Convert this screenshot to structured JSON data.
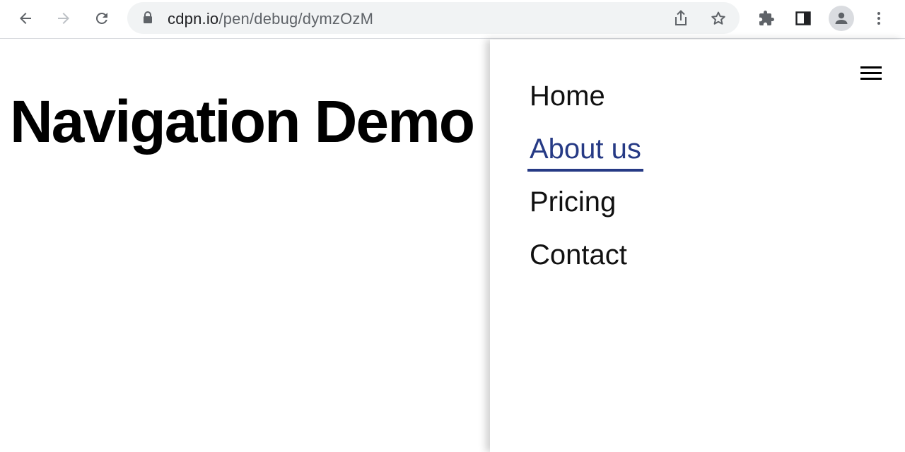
{
  "browser": {
    "url_host": "cdpn.io",
    "url_path": "/pen/debug/dymzOzM",
    "icons": [
      "back-arrow-icon",
      "forward-arrow-icon",
      "reload-icon",
      "lock-icon",
      "share-icon",
      "star-icon",
      "extensions-icon",
      "side-panel-icon",
      "profile-icon",
      "menu-dots-icon"
    ]
  },
  "page": {
    "title": "Navigation Demo"
  },
  "nav": {
    "items": [
      {
        "label": "Home",
        "active": false
      },
      {
        "label": "About us",
        "active": true
      },
      {
        "label": "Pricing",
        "active": false
      },
      {
        "label": "Contact",
        "active": false
      }
    ],
    "accent_color": "#263a85"
  }
}
